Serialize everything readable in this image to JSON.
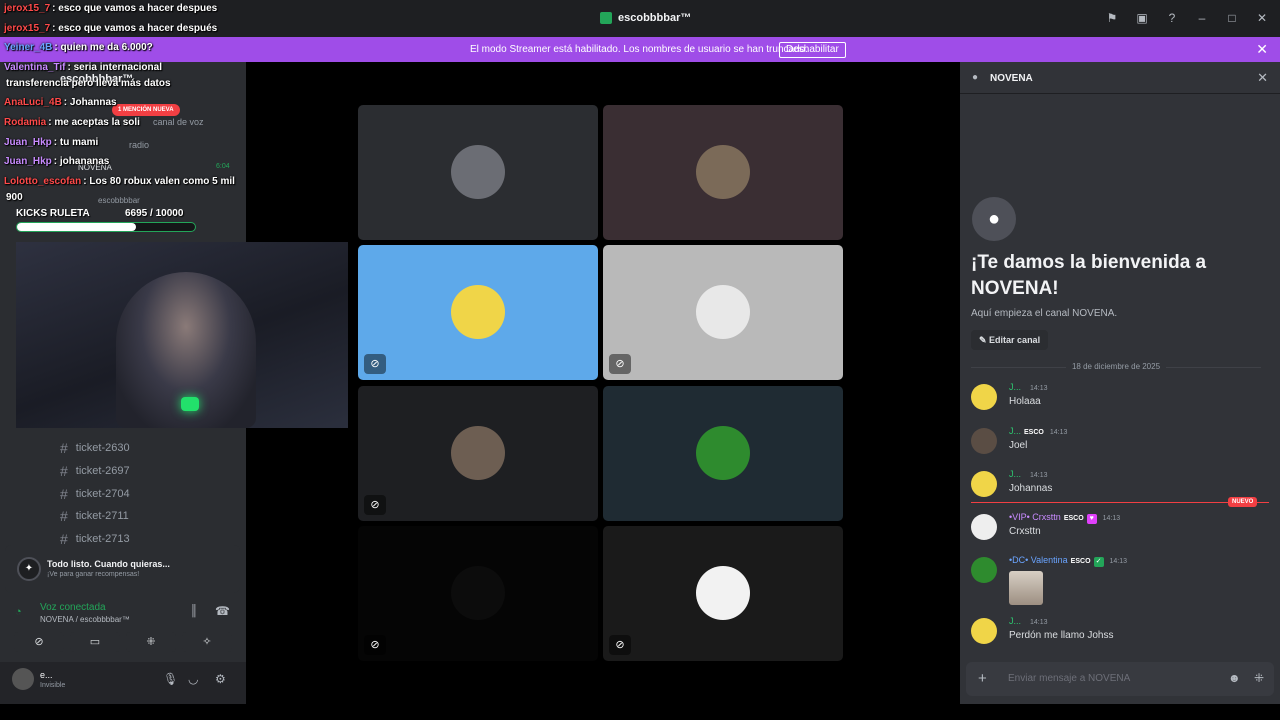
{
  "app": {
    "title": "escobbbbar™"
  },
  "banner": {
    "text": "El modo Streamer está habilitado. Los nombres de usuario se han truncado.",
    "button": "Deshabilitar"
  },
  "sidebar": {
    "server_name": "escobbbbar™",
    "channels": [
      "ticket-2630",
      "ticket-2697",
      "ticket-2704",
      "ticket-2711",
      "ticket-2713"
    ],
    "behind_overlay": {
      "new_mention": "1 MENCIÓN NUEVA",
      "items": [
        "canal de voz",
        "radio",
        "NOVENA"
      ],
      "voice_time": "6:04",
      "member": "escobbbbar"
    }
  },
  "promo": {
    "title": "Todo listo. Cuando quieras...",
    "subtitle": "¡Ve para ganar recompensas!"
  },
  "voice": {
    "status": "Voz conectada",
    "channel": "NOVENA / escobbbbar™"
  },
  "user": {
    "name": "e...",
    "status": "Invisible"
  },
  "stream_chat": [
    {
      "user": "jerox15_7",
      "text": ": esco que vamos a hacer despues",
      "color": "#ff4a4a"
    },
    {
      "user": "jerox15_7",
      "text": ": esco que vamos a hacer después",
      "color": "#ff4a4a"
    },
    {
      "user": "Yeiner_4B",
      "text": ": quien me da 6.000?",
      "color": "#6aa4ff"
    },
    {
      "user": "Valentina_Tif",
      "text": ": seria internacional",
      "color": "#c88bff"
    },
    {
      "user": "",
      "text": "transferencia pero lleva más datos",
      "color": "#ffffff"
    },
    {
      "user": "AnaLuci_4B",
      "text": ": Johannas",
      "color": "#ff4a4a"
    },
    {
      "user": "Rodamia",
      "text": ": me aceptas la soli",
      "color": "#ff4a4a"
    },
    {
      "user": "Juan_Hkp",
      "text": ": tu mami",
      "color": "#c88bff"
    },
    {
      "user": "Juan_Hkp",
      "text": ": johananas",
      "color": "#c88bff"
    },
    {
      "user": "Lolotto_escofan",
      "text": ": Los 80 robux valen como 5 mil",
      "color": "#ff4a4a"
    },
    {
      "user": "",
      "text": "900",
      "color": "#ffffff"
    }
  ],
  "kicks": {
    "label": "KICKS RULETA",
    "value": "6695 / 10000",
    "progress": 0.6695
  },
  "tiles": [
    {
      "name": "tile-1",
      "bg": "#2b2d31",
      "av": "#6b6d74",
      "muted": false
    },
    {
      "name": "tile-2",
      "bg": "#3a2e33",
      "av": "#7b6a58",
      "muted": false
    },
    {
      "name": "tile-3",
      "bg": "#5ea9ea",
      "av": "#f0d548",
      "muted": true
    },
    {
      "name": "tile-4",
      "bg": "#b9b9b9",
      "av": "#e8e8e8",
      "muted": true
    },
    {
      "name": "tile-5",
      "bg": "#1e1f22",
      "av": "#6d5e52",
      "muted": true
    },
    {
      "name": "tile-6",
      "bg": "#1f2b33",
      "av": "#2e8b2e",
      "muted": false
    },
    {
      "name": "tile-7",
      "bg": "#050505",
      "av": "#0c0c0c",
      "muted": true
    },
    {
      "name": "tile-8",
      "bg": "#1a1a1a",
      "av": "#f2f2f2",
      "muted": true
    }
  ],
  "panel": {
    "title": "NOVENA",
    "welcome_title": "¡Te damos la bienvenida a NOVENA!",
    "welcome_sub": "Aquí empieza el canal NOVENA.",
    "edit_button": "Editar canal",
    "date": "18 de diciembre de 2025",
    "new_label": "NUEVO",
    "messages": [
      {
        "user": "J...",
        "time": "14:13",
        "text": "Holaaa",
        "color": "#2dc770",
        "tag": "",
        "av": "#f0d548"
      },
      {
        "user": "J...",
        "time": "14:13",
        "text": "Joel",
        "color": "#2dc770",
        "tag": "ESCO",
        "av": "#5a4d44"
      },
      {
        "user": "J...",
        "time": "14:13",
        "text": "Johannas",
        "color": "#2dc770",
        "tag": "",
        "av": "#f0d548"
      },
      {
        "user": "•VIP• Crxsttn",
        "time": "14:13",
        "text": "Crxsttn",
        "color": "#c88bff",
        "tag": "ESCO",
        "av": "#eeeeee"
      },
      {
        "user": "•DC• Valentina",
        "time": "14:13",
        "text": "",
        "color": "#6aa4ff",
        "tag": "ESCO",
        "av": "#2e8b2e"
      },
      {
        "user": "J...",
        "time": "14:13",
        "text": "Perdón me llamo Johss",
        "color": "#2dc770",
        "tag": "",
        "av": "#f0d548"
      }
    ],
    "composer_placeholder": "Enviar mensaje a NOVENA"
  }
}
